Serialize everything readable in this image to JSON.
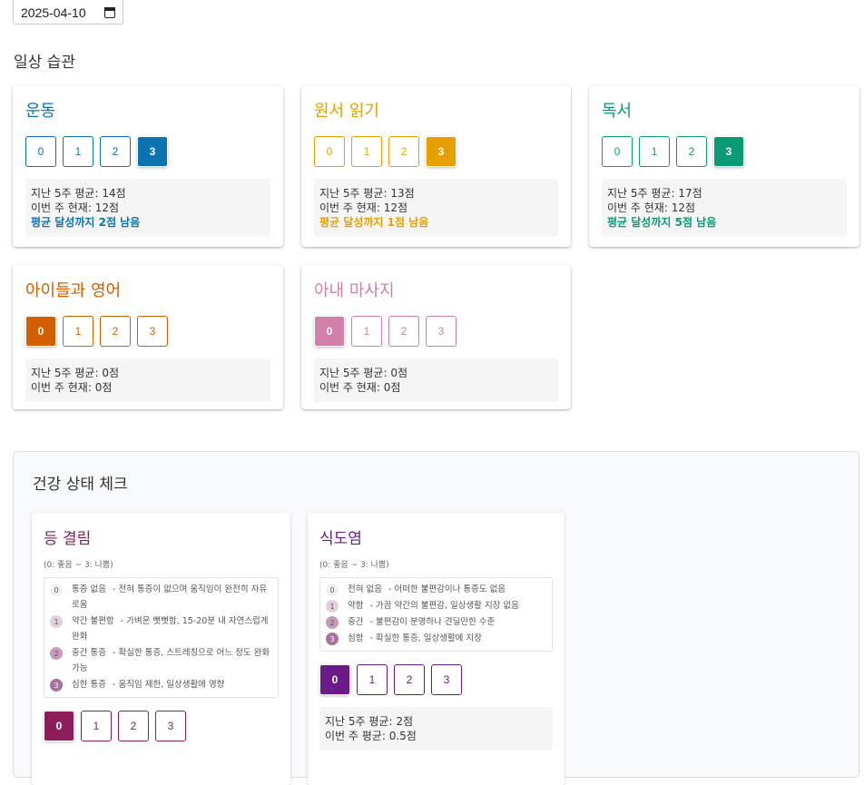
{
  "date_value": "2025-04-10",
  "habits_title": "일상 습관",
  "labels": {
    "past_avg": "지난 5주 평균:",
    "this_week": "이번 주 현재:",
    "this_week_avg": "이번 주 평균:"
  },
  "habits": [
    {
      "title": "운동",
      "color": "#0b73b0",
      "selected": 3,
      "avg": "14점",
      "current": "12점",
      "remain": "평균 달성까지 2점 남음"
    },
    {
      "title": "원서 읽기",
      "color": "#e6a100",
      "selected": 3,
      "avg": "13점",
      "current": "12점",
      "remain": "평균 달성까지 1점 남음"
    },
    {
      "title": "독서",
      "color": "#0a9b74",
      "selected": 3,
      "avg": "17점",
      "current": "12점",
      "remain": "평균 달성까지 5점 남음"
    },
    {
      "title": "아이들과 영어",
      "color": "#d35f00",
      "selected": 0,
      "avg": "0점",
      "current": "0점",
      "remain": ""
    },
    {
      "title": "아내 마사지",
      "color": "#d27fa9",
      "selected": 0,
      "avg": "0점",
      "current": "0점",
      "remain": ""
    }
  ],
  "button_labels": [
    "0",
    "1",
    "2",
    "3"
  ],
  "health": {
    "title": "건강 상태 체크",
    "cards": [
      {
        "title": "등 결림",
        "scale_note": "(0: 좋음 ~ 3: 나쁨)",
        "color": "#8b1d5a",
        "selected": 0,
        "legend": [
          {
            "num": "0",
            "name": "통증 없음",
            "desc": "- 전혀 통증이 없으며 움직임이 완전히 자유로움"
          },
          {
            "num": "1",
            "name": "약간 불편함",
            "desc": "- 가벼운 뻣뻣함, 15-20분 내 자연스럽게 완화"
          },
          {
            "num": "2",
            "name": "중간 통증",
            "desc": "- 확실한 통증, 스트레칭으로 어느 정도 완화 가능"
          },
          {
            "num": "3",
            "name": "심한 통증",
            "desc": "- 움직임 제한, 일상생활에 영향"
          }
        ],
        "avg": "",
        "current": ""
      },
      {
        "title": "식도염",
        "scale_note": "(0: 좋음 ~ 3: 나쁨)",
        "color": "#6b1a8a",
        "selected": 0,
        "legend": [
          {
            "num": "0",
            "name": "전혀 없음",
            "desc": "- 어떠한 불편감이나 통증도 없음"
          },
          {
            "num": "1",
            "name": "약함",
            "desc": "- 가끔 약간의 불편감, 일상생활 지장 없음"
          },
          {
            "num": "2",
            "name": "중간",
            "desc": "- 불편감이 분명하나 견딜만한 수준"
          },
          {
            "num": "3",
            "name": "심함",
            "desc": "- 확실한 통증, 일상생활에 지장"
          }
        ],
        "avg": "2점",
        "current": "0.5점"
      }
    ]
  },
  "circle_colors": [
    "#f0f0f0",
    "#e4cfe0",
    "#c79ab9",
    "#a8739a"
  ]
}
